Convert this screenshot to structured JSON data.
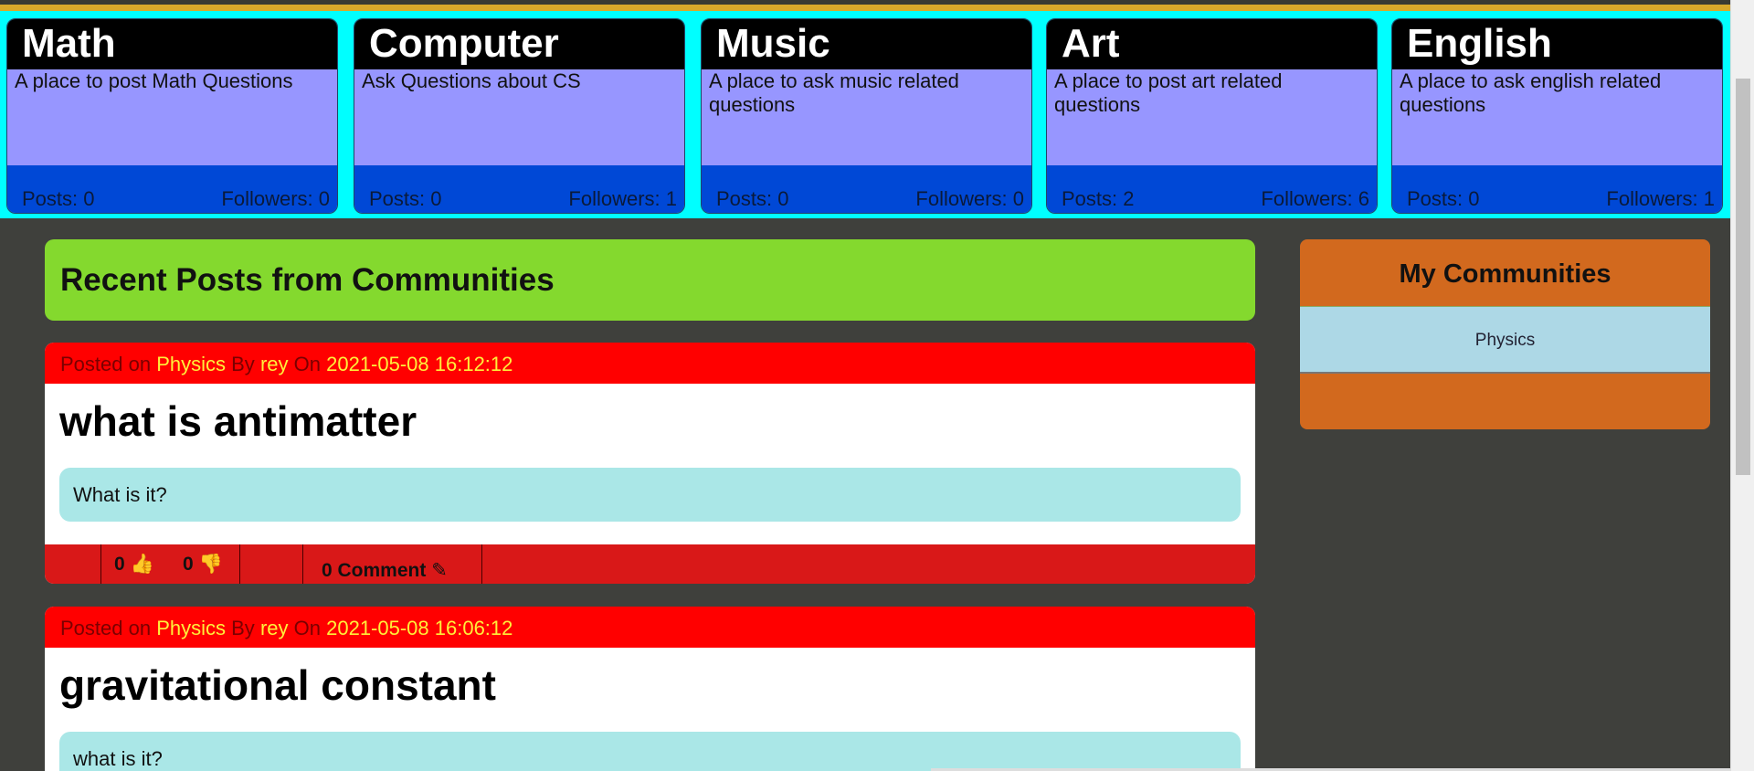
{
  "communities": [
    {
      "name": "Math",
      "description": "A place to post Math Questions",
      "posts": "Posts: 0",
      "followers": "Followers: 0"
    },
    {
      "name": "Computer",
      "description": "Ask Questions about CS",
      "posts": "Posts: 0",
      "followers": "Followers: 1"
    },
    {
      "name": "Music",
      "description": "A place to ask music related questions",
      "posts": "Posts: 0",
      "followers": "Followers: 0"
    },
    {
      "name": "Art",
      "description": "A place to post art related questions",
      "posts": "Posts: 2",
      "followers": "Followers: 6"
    },
    {
      "name": "English",
      "description": "A place to ask english related questions",
      "posts": "Posts: 0",
      "followers": "Followers: 1"
    }
  ],
  "recent_title": "Recent Posts from Communities",
  "posts": [
    {
      "posted_on": "Posted on",
      "community": "Physics",
      "by": "By",
      "author": "rey",
      "on": "On",
      "date": "2021-05-08 16:12:12",
      "title": "what is antimatter",
      "body": "What is it?",
      "likes": "0",
      "dislikes": "0",
      "comments": "0 Comment"
    },
    {
      "posted_on": "Posted on",
      "community": "Physics",
      "by": "By",
      "author": "rey",
      "on": "On",
      "date": "2021-05-08 16:06:12",
      "title": "gravitational constant",
      "body": "what is it?"
    }
  ],
  "sidebar": {
    "title": "My Communities",
    "items": [
      "Physics"
    ]
  }
}
